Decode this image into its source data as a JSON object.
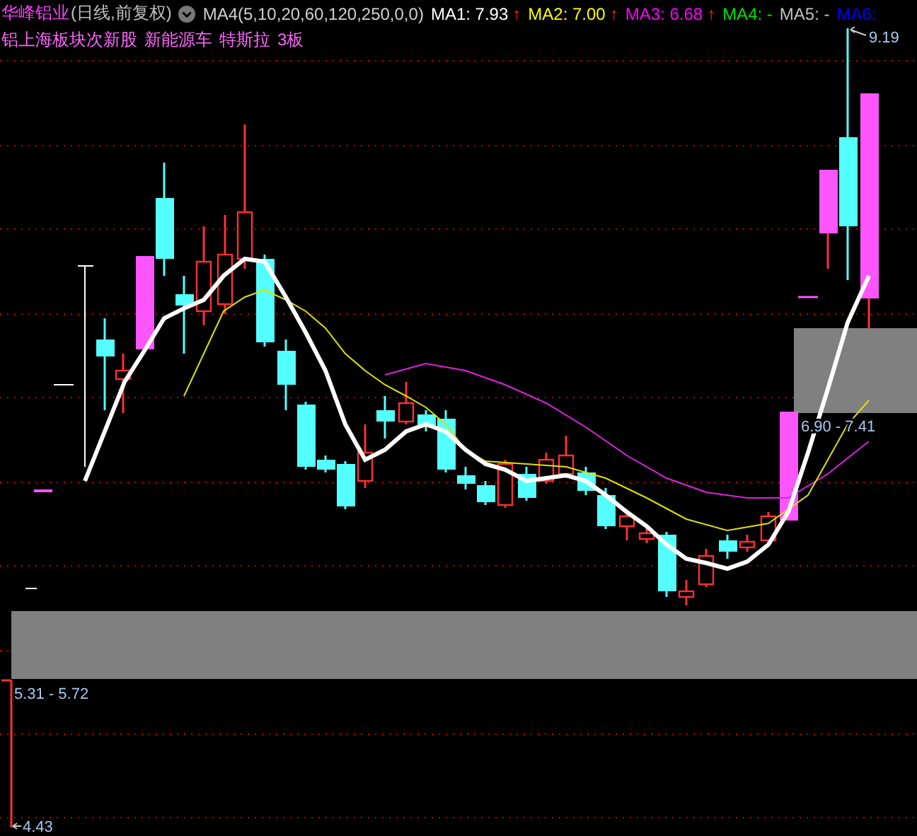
{
  "header": {
    "stock_name": "华峰铝业",
    "period": "(日线,前复权)",
    "indicator": "MA4(5,10,20,60,120,250,0,0)",
    "averages": [
      {
        "label": "MA1:",
        "value": "7.93",
        "arrow": "↑",
        "color": "#ffffff"
      },
      {
        "label": "MA2:",
        "value": "7.00",
        "arrow": "↑",
        "color": "#ffff00"
      },
      {
        "label": "MA3:",
        "value": "6.68",
        "arrow": "↑",
        "color": "#ff00ff"
      },
      {
        "label": "MA4:",
        "value": "-",
        "color": "#00e000"
      },
      {
        "label": "MA5:",
        "value": "-",
        "color": "#c0c0c0"
      },
      {
        "label": "MA6:",
        "color": "#0000ff"
      }
    ],
    "tags": [
      "铝上海板块次新股",
      "新能源车",
      "特斯拉",
      "3板"
    ]
  },
  "chart": {
    "high_label": "9.19",
    "low_label": "4.43",
    "zones": [
      "5.31 - 5.72",
      "6.90 - 7.41"
    ]
  }
}
